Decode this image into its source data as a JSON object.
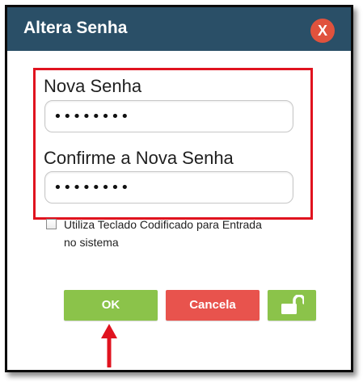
{
  "dialog": {
    "title": "Altera Senha",
    "close_label": "X"
  },
  "fields": {
    "new_password": {
      "label": "Nova Senha",
      "value": "••••••••"
    },
    "confirm_password": {
      "label": "Confirme a Nova Senha",
      "value": "••••••••"
    }
  },
  "options": {
    "coded_keyboard": {
      "label": "Utiliza Teclado Codificado para Entrada no sistema",
      "checked": false
    }
  },
  "buttons": {
    "ok": "OK",
    "cancel": "Cancela",
    "lock_icon": "unlock-icon"
  },
  "colors": {
    "titlebar": "#2a4f67",
    "close_button": "#e0523d",
    "highlight_border": "#e0131f",
    "ok_button": "#8bc34a",
    "cancel_button": "#e8534d",
    "lock_button": "#8bc34a",
    "annotation_arrow": "#e0131f"
  }
}
